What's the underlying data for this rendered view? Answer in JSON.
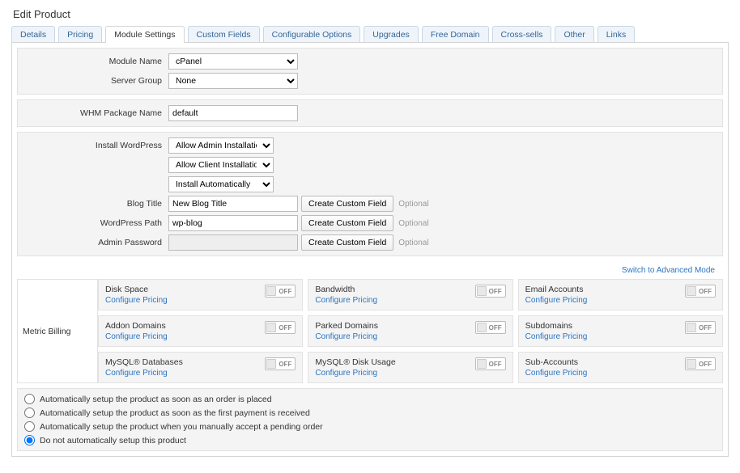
{
  "page_title": "Edit Product",
  "tabs": [
    "Details",
    "Pricing",
    "Module Settings",
    "Custom Fields",
    "Configurable Options",
    "Upgrades",
    "Free Domain",
    "Cross-sells",
    "Other",
    "Links"
  ],
  "active_tab_index": 2,
  "module": {
    "name_label": "Module Name",
    "name_value": "cPanel",
    "group_label": "Server Group",
    "group_value": "None"
  },
  "whm": {
    "label": "WHM Package Name",
    "value": "default"
  },
  "wp": {
    "install_label": "Install WordPress",
    "select1": "Allow Admin Installation",
    "select2": "Allow Client Installation",
    "select3": "Install Automatically",
    "blog_title_label": "Blog Title",
    "blog_title_value": "New Blog Title",
    "path_label": "WordPress Path",
    "path_value": "wp-blog",
    "admin_pw_label": "Admin Password",
    "admin_pw_value": "",
    "create_field_btn": "Create Custom Field",
    "optional": "Optional"
  },
  "advanced_link": "Switch to Advanced Mode",
  "metric_billing_label": "Metric Billing",
  "configure_pricing": "Configure Pricing",
  "toggle_off": "OFF",
  "metrics": [
    "Disk Space",
    "Bandwidth",
    "Email Accounts",
    "Addon Domains",
    "Parked Domains",
    "Subdomains",
    "MySQL® Databases",
    "MySQL® Disk Usage",
    "Sub-Accounts"
  ],
  "auto_setup": {
    "opt0": "Automatically setup the product as soon as an order is placed",
    "opt1": "Automatically setup the product as soon as the first payment is received",
    "opt2": "Automatically setup the product when you manually accept a pending order",
    "opt3": "Do not automatically setup this product",
    "selected_index": 3
  }
}
